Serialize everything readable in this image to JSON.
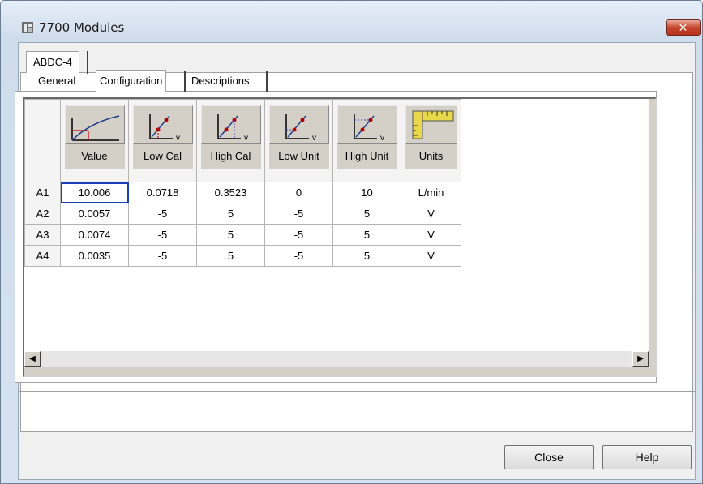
{
  "window": {
    "title": "7700 Modules",
    "close_glyph": "✕"
  },
  "outer_tabs": [
    {
      "label": "ABDC-4"
    }
  ],
  "inner_tabs": [
    {
      "label": "General"
    },
    {
      "label": "Configuration"
    },
    {
      "label": "Descriptions"
    }
  ],
  "grid": {
    "columns": [
      {
        "label": "Value",
        "icon": "value-curve-icon"
      },
      {
        "label": "Low Cal",
        "icon": "low-cal-icon"
      },
      {
        "label": "High Cal",
        "icon": "high-cal-icon"
      },
      {
        "label": "Low Unit",
        "icon": "low-unit-icon"
      },
      {
        "label": "High Unit",
        "icon": "high-unit-icon"
      },
      {
        "label": "Units",
        "icon": "ruler-icon"
      }
    ],
    "rows": [
      {
        "label": "A1",
        "cells": [
          "10.006",
          "0.0718",
          "0.3523",
          "0",
          "10",
          "L/min"
        ]
      },
      {
        "label": "A2",
        "cells": [
          "0.0057",
          "-5",
          "5",
          "-5",
          "5",
          "V"
        ]
      },
      {
        "label": "A3",
        "cells": [
          "0.0074",
          "-5",
          "5",
          "-5",
          "5",
          "V"
        ]
      },
      {
        "label": "A4",
        "cells": [
          "0.0035",
          "-5",
          "5",
          "-5",
          "5",
          "V"
        ]
      }
    ]
  },
  "scrollbar": {
    "left_arrow": "◀",
    "right_arrow": "▶"
  },
  "buttons": {
    "close": "Close",
    "help": "Help"
  }
}
